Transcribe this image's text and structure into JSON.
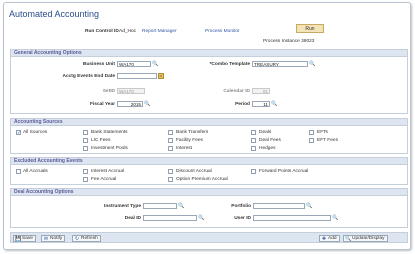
{
  "page": {
    "title": "Automated Accounting"
  },
  "run": {
    "run_control_label": "Run Control ID",
    "run_control_value": "Ad_Hoc",
    "report_manager": "Report Manager",
    "process_monitor": "Process Monitor",
    "run_button": "Run",
    "process_instance_label": "Process Instance",
    "process_instance_value": "39023"
  },
  "general": {
    "header": "General Accounting Options",
    "business_unit_label": "Business Unit",
    "business_unit_value": "WA170",
    "combo_template_label": "*Combo Template",
    "combo_template_value": "TREASURY",
    "events_end_date_label": "Acctg Events End Date",
    "events_end_date_value": "",
    "setid_label": "SetID",
    "setid_value": "WA170",
    "calendar_id_label": "Calendar ID",
    "calendar_id_value": "01",
    "fiscal_year_label": "Fiscal Year",
    "fiscal_year_value": "2015",
    "period_label": "Period",
    "period_value": "11"
  },
  "sources": {
    "header": "Accounting Sources",
    "items": [
      {
        "label": "All Sources",
        "checked": true
      },
      {
        "label": "Bank Statements",
        "checked": false
      },
      {
        "label": "Bank Transfers",
        "checked": false
      },
      {
        "label": "Deals",
        "checked": false
      },
      {
        "label": "EFTs",
        "checked": false
      },
      {
        "label": "LIC Fees",
        "checked": false
      },
      {
        "label": "Facility Fees",
        "checked": false
      },
      {
        "label": "Deal Fees",
        "checked": false
      },
      {
        "label": "EFT Fees",
        "checked": false
      },
      {
        "label": "Investment Pools",
        "checked": false
      },
      {
        "label": "Interest",
        "checked": false
      },
      {
        "label": "Hedges",
        "checked": false
      }
    ]
  },
  "excluded": {
    "header": "Excluded Accounting Events",
    "items": [
      {
        "label": "All Accruals",
        "checked": false
      },
      {
        "label": "Interest Accrual",
        "checked": false
      },
      {
        "label": "Discount Accrual",
        "checked": false
      },
      {
        "label": "Forward Points Accrual",
        "checked": false
      },
      {
        "label": "Fee Accrual",
        "checked": false
      },
      {
        "label": "Option Premium Accrual",
        "checked": false
      }
    ]
  },
  "deal": {
    "header": "Deal Accounting Options",
    "instrument_type_label": "Instrument Type",
    "instrument_type_value": "",
    "portfolio_label": "Portfolio",
    "portfolio_value": "",
    "deal_id_label": "Deal ID",
    "deal_id_value": "",
    "user_id_label": "User ID",
    "user_id_value": ""
  },
  "toolbar": {
    "save": "Save",
    "notify": "Notify",
    "refresh": "Refresh",
    "add": "Add",
    "update_display": "Update/Display"
  }
}
